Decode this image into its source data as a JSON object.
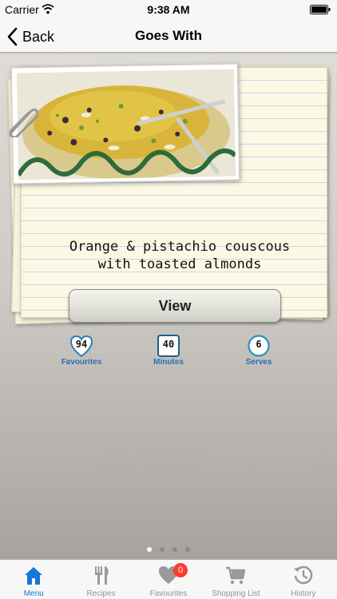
{
  "status_bar": {
    "carrier": "Carrier",
    "time": "9:38 AM"
  },
  "nav": {
    "back_label": "Back",
    "title": "Goes With"
  },
  "recipe": {
    "title_line1": "Orange & pistachio couscous",
    "title_line2": "with toasted almonds",
    "view_label": "View",
    "stats": [
      {
        "value": "94",
        "label": "Favourites",
        "icon": "heart-icon"
      },
      {
        "value": "40",
        "label": "Minutes",
        "icon": "clock-square-icon"
      },
      {
        "value": "6",
        "label": "Serves",
        "icon": "plate-circle-icon"
      }
    ]
  },
  "pager": {
    "count": 4,
    "active_index": 0
  },
  "tabs": [
    {
      "label": "Menu",
      "icon": "home-icon",
      "active": true
    },
    {
      "label": "Recipes",
      "icon": "fork-knife-icon",
      "active": false
    },
    {
      "label": "Favourites",
      "icon": "heart-icon",
      "active": false,
      "badge": "0"
    },
    {
      "label": "Shopping List",
      "icon": "cart-icon",
      "active": false
    },
    {
      "label": "History",
      "icon": "history-icon",
      "active": false
    }
  ],
  "colors": {
    "accent": "#1478d6",
    "badge": "#ff3b30",
    "stat_label": "#2e6fb3"
  }
}
